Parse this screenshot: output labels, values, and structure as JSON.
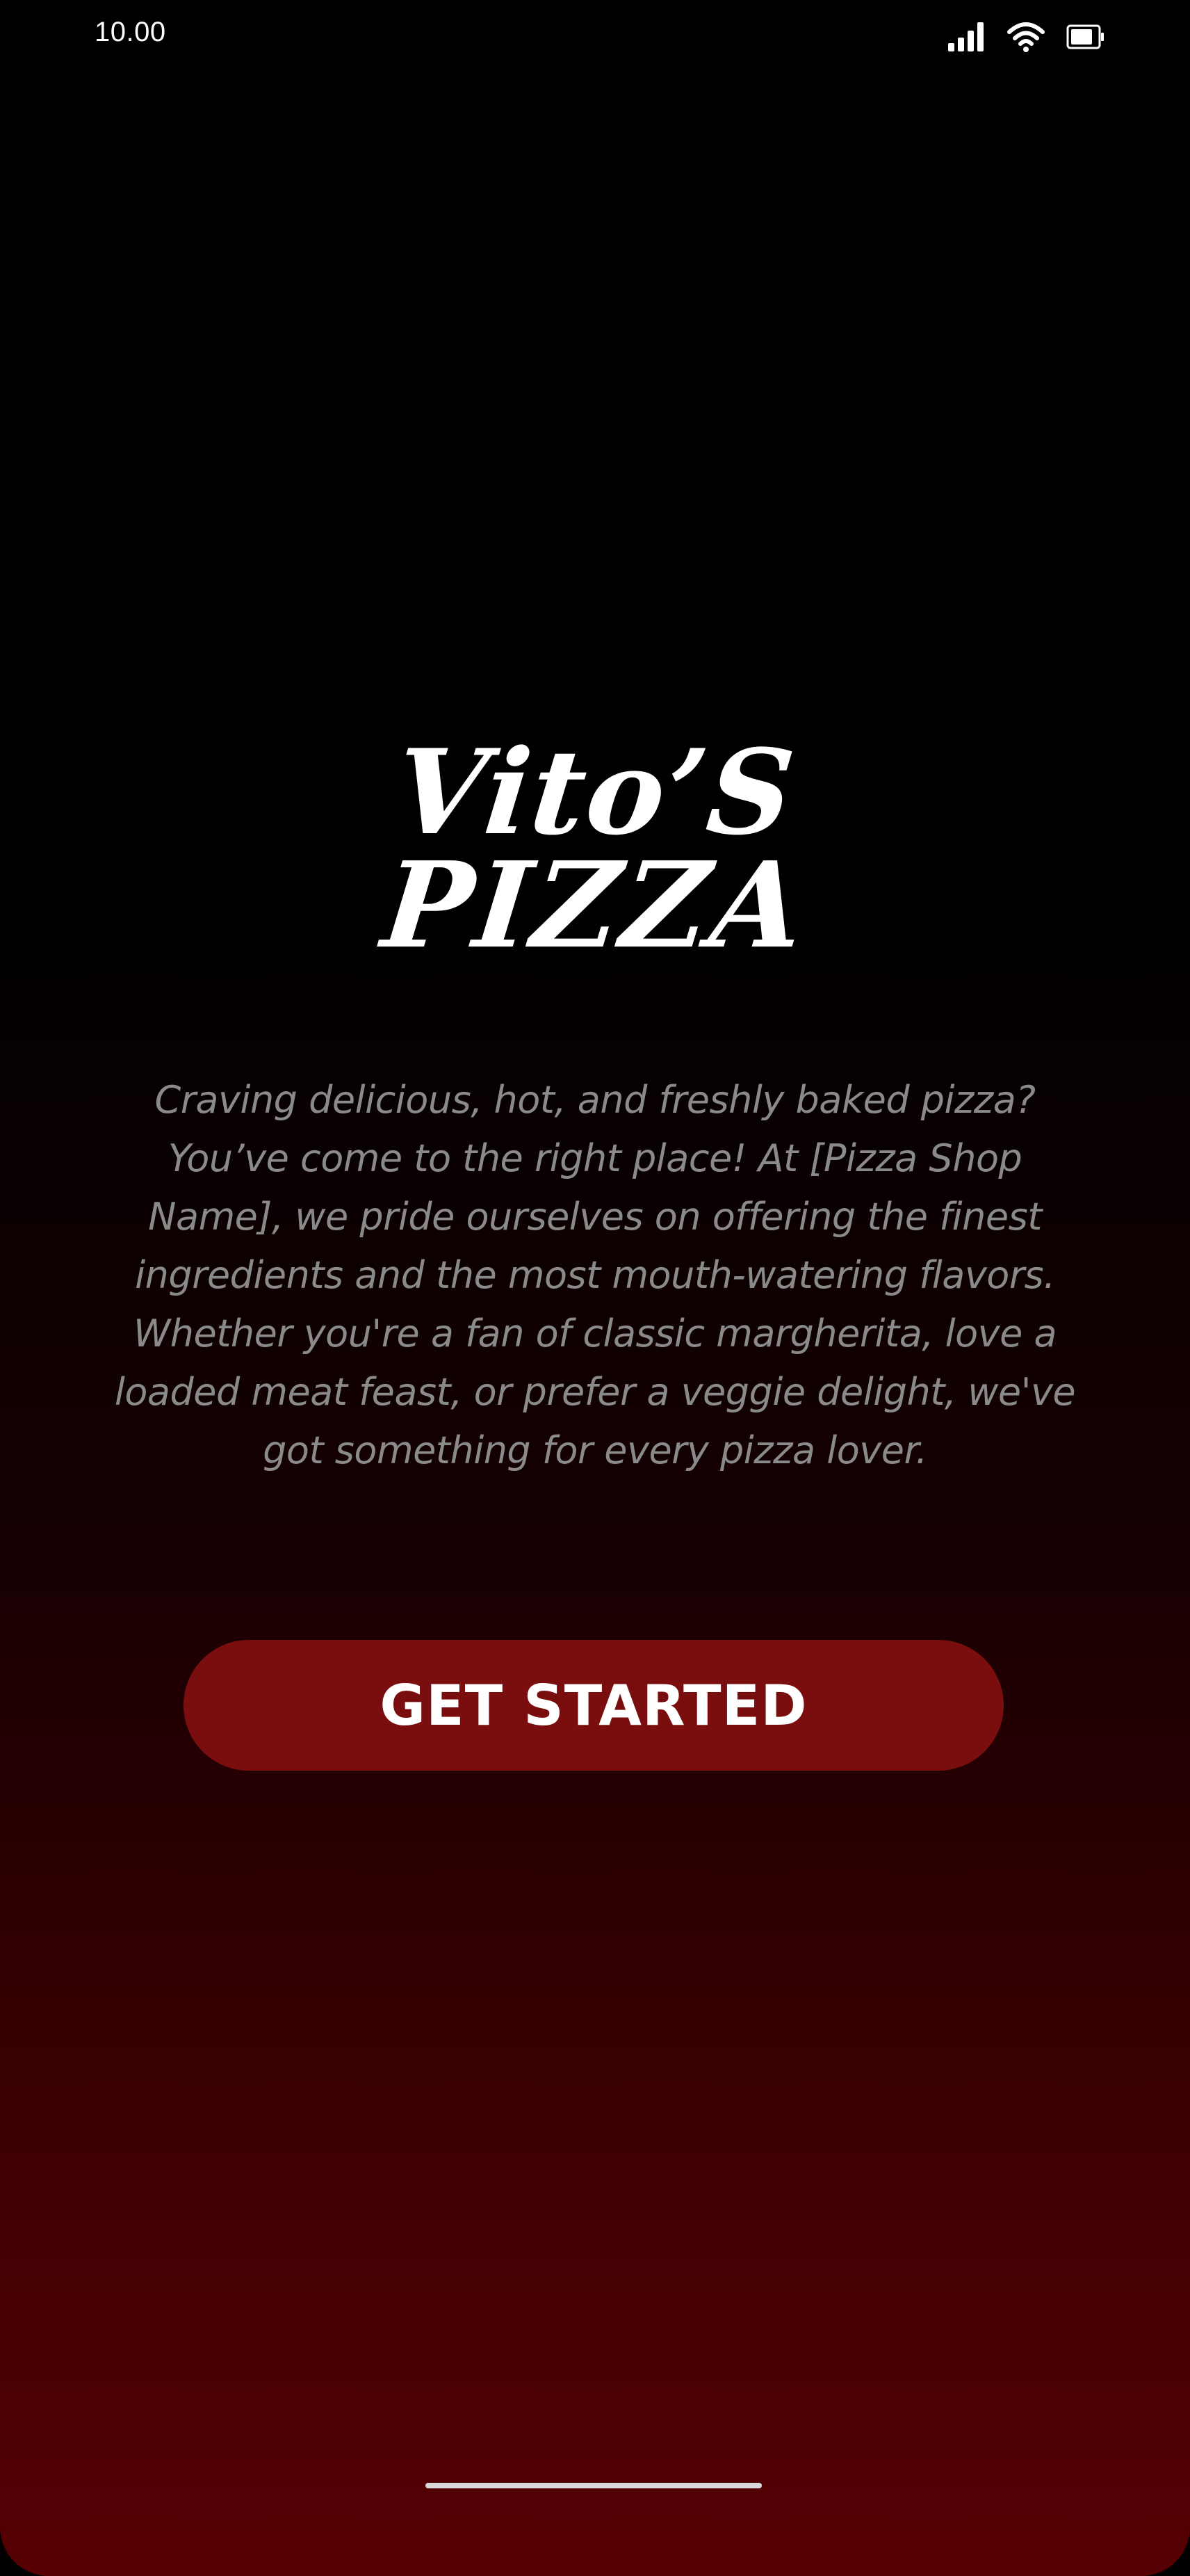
{
  "status_bar": {
    "time": "10.00",
    "icons": [
      "signal-icon",
      "wifi-icon",
      "battery-icon"
    ]
  },
  "brand": {
    "line1": "Vito’S",
    "line2": "PIZZA"
  },
  "intro": {
    "description": "Craving delicious, hot, and freshly baked pizza? You’ve come to the right place! At [Pizza Shop Name], we pride ourselves on offering the finest ingredients and the most mouth-watering flavors. Whether you're a fan of classic margherita, love a loaded meat feast, or prefer a veggie delight, we've got something for every pizza lover."
  },
  "cta": {
    "label": "GET STARTED"
  },
  "colors": {
    "background_top": "#000000",
    "background_bottom": "#560003",
    "button": "#7a0e0e",
    "text_primary": "#ffffff",
    "text_secondary": "#8a8a8a"
  }
}
